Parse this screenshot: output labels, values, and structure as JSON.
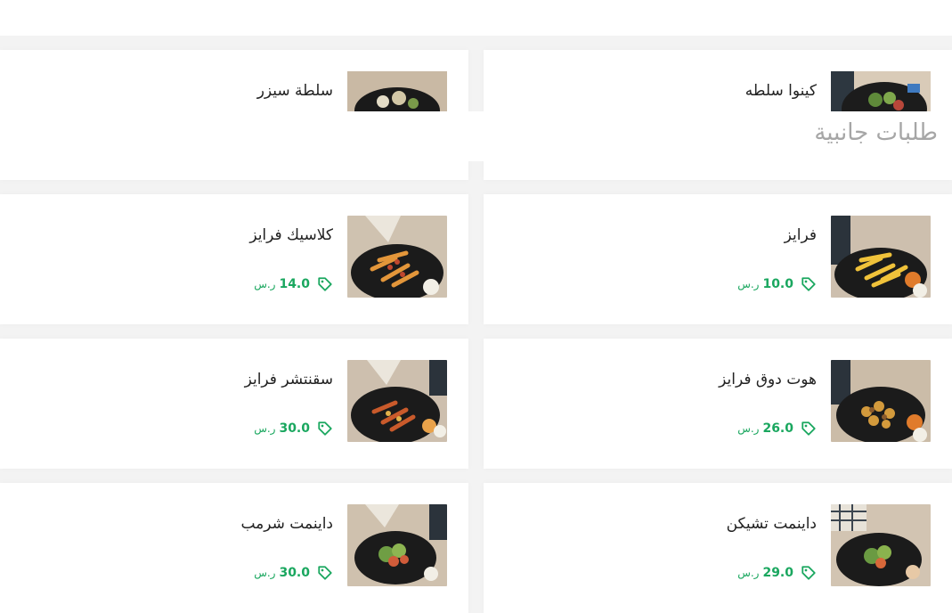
{
  "section": {
    "title": "طلبات جانبية"
  },
  "top_items": [
    {
      "name": "كينوا سلطه"
    },
    {
      "name": "سلطة سيزر"
    }
  ],
  "items": [
    {
      "name": "فرايز",
      "price": "10.0",
      "currency": "ر.س",
      "icon": "tag-icon"
    },
    {
      "name": "كلاسيك فرايز",
      "price": "14.0",
      "currency": "ر.س",
      "icon": "tag-icon"
    },
    {
      "name": "هوت دوق فرايز",
      "price": "26.0",
      "currency": "ر.س",
      "icon": "tag-icon"
    },
    {
      "name": "سقنتشر فرايز",
      "price": "30.0",
      "currency": "ر.س",
      "icon": "tag-icon"
    },
    {
      "name": "داينمت تشيكن",
      "price": "29.0",
      "currency": "ر.س",
      "icon": "tag-icon"
    },
    {
      "name": "داينمت شرمب",
      "price": "30.0",
      "currency": "ر.س",
      "icon": "tag-icon"
    }
  ],
  "colors": {
    "price": "#1aa75f",
    "title": "#a6a6a6",
    "background": "#f3f3f3",
    "card": "#ffffff"
  }
}
